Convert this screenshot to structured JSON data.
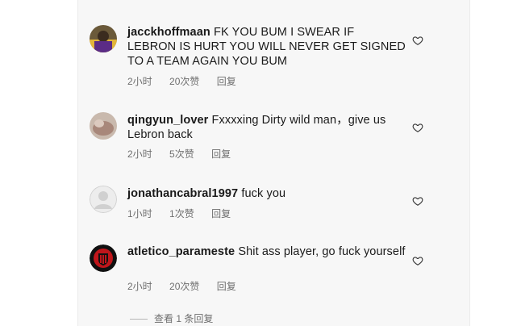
{
  "comments": [
    {
      "username": "jacckhoffmaan",
      "text": "FK YOU BUM I SWEAR IF LEBRON IS HURT YOU WILL NEVER GET SIGNED TO A TEAM AGAIN YOU BUM",
      "time": "2小时",
      "likes": "20次赞",
      "reply": "回复",
      "avatar": "photo-avatar"
    },
    {
      "username": "qingyun_lover",
      "text": "Fxxxxing Dirty wild man，give us Lebron back",
      "time": "2小时",
      "likes": "5次赞",
      "reply": "回复",
      "avatar": "photo-avatar"
    },
    {
      "username": "jonathancabral1997",
      "text": "fuck you",
      "time": "1小时",
      "likes": "1次赞",
      "reply": "回复",
      "avatar": "default-avatar"
    },
    {
      "username": "atletico_parameste",
      "text": "Shit ass player, go fuck yourself",
      "time": "2小时",
      "likes": "20次赞",
      "reply": "回复",
      "avatar": "club-crest-avatar"
    }
  ],
  "view_replies": "查看 1 条回复",
  "colors": {
    "panel_bg": "#f7f7f7",
    "meta_text": "#6f6f6f",
    "crest_red": "#c0161b"
  }
}
